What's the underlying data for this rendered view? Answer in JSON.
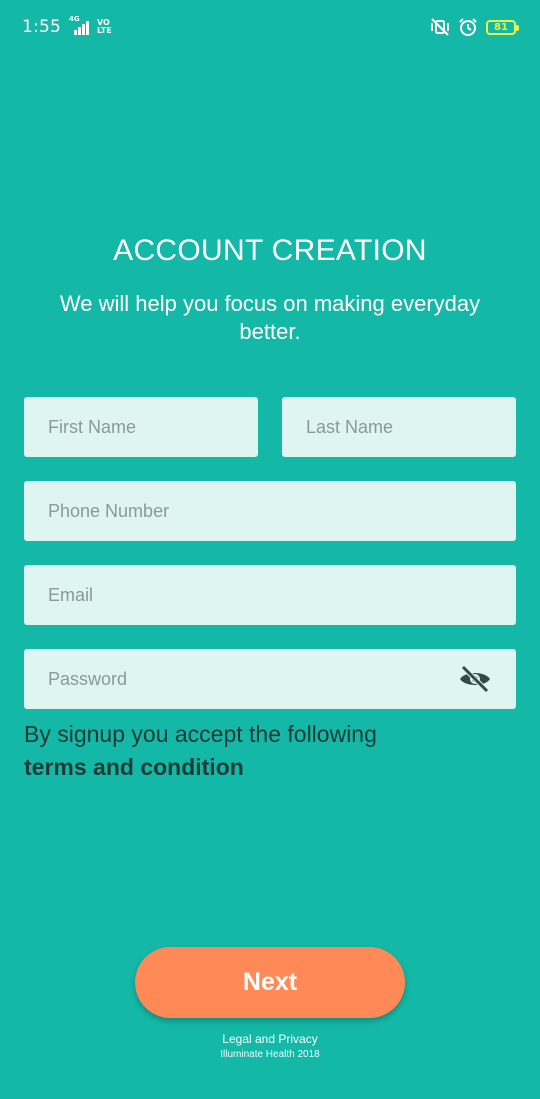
{
  "status_bar": {
    "time": "1:55",
    "network": "4G",
    "volte_top": "VO",
    "volte_bottom": "LTE",
    "battery": "81",
    "battery_color": "#e9f542",
    "icons": [
      "vibrate-off-icon",
      "alarm-icon"
    ]
  },
  "header": {
    "title": "ACCOUNT CREATION",
    "subtitle": "We will help you focus on making everyday better."
  },
  "form": {
    "first_name_placeholder": "First Name",
    "last_name_placeholder": "Last Name",
    "phone_placeholder": "Phone Number",
    "email_placeholder": "Email",
    "password_placeholder": "Password",
    "password_toggle_icon": "eye-off-icon"
  },
  "terms": {
    "text": "By signup you accept the following",
    "link": "terms and condition"
  },
  "actions": {
    "next_label": "Next",
    "next_color": "#ff8a57"
  },
  "footer": {
    "legal": "Legal and Privacy",
    "copyright": "Illuminate Health 2018"
  },
  "theme": {
    "background": "#14b8a6",
    "field_bg": "#dff5f2"
  }
}
